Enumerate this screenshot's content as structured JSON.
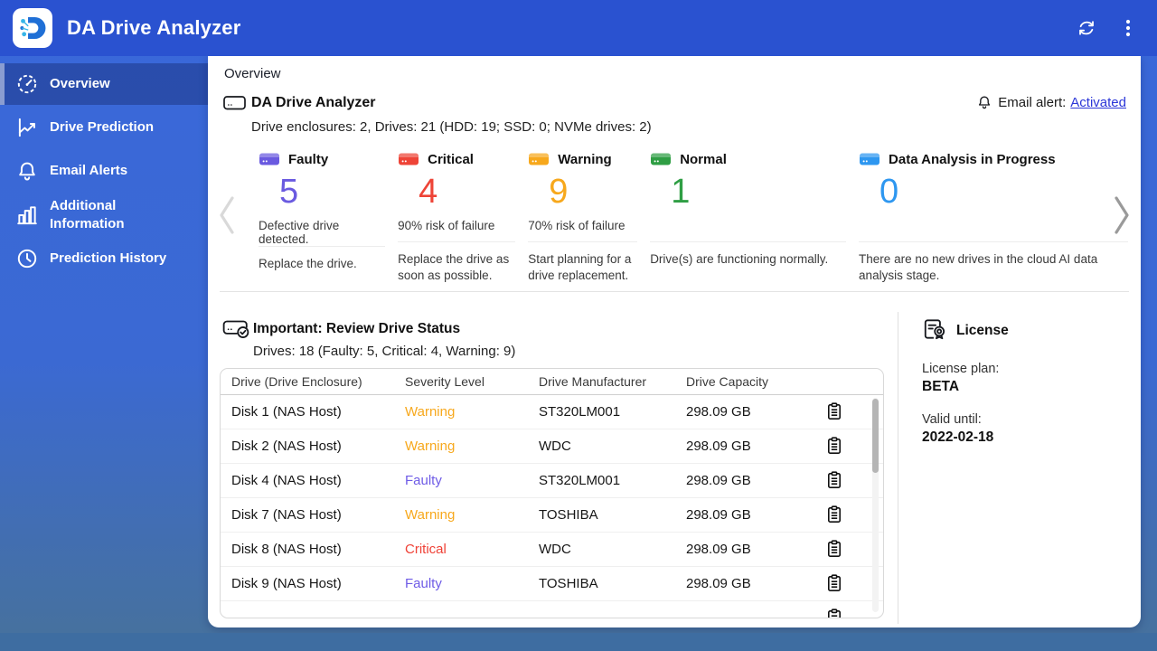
{
  "topbar": {
    "title": "DA Drive Analyzer",
    "actions": [
      {
        "name": "refresh",
        "icon": "refresh-icon"
      },
      {
        "name": "more-options",
        "icon": "kebab-icon"
      }
    ]
  },
  "sidebar": {
    "items": [
      {
        "label": "Overview",
        "icon": "gauge-icon",
        "selected": true
      },
      {
        "label": "Drive Prediction",
        "icon": "linechart-icon",
        "selected": false
      },
      {
        "label": "Email Alerts",
        "icon": "bell-icon",
        "selected": false
      },
      {
        "label": "Additional Information",
        "icon": "barchart-icon",
        "selected": false
      },
      {
        "label": "Prediction History",
        "icon": "clock-icon",
        "selected": false
      }
    ]
  },
  "content": {
    "tab_label": "Overview",
    "summary": {
      "title": "DA Drive Analyzer",
      "subtitle": "Drive enclosures: 2, Drives: 21 (HDD: 19; SSD: 0; NVMe drives: 2)",
      "email_alert_label": "Email alert:",
      "email_alert_link": "Activated"
    },
    "status_cards": [
      {
        "label": "Faulty",
        "count": "5",
        "subtitle": "Defective drive detected.",
        "description": "Replace the drive.",
        "color": "#6a5ae0"
      },
      {
        "label": "Critical",
        "count": "4",
        "subtitle": "90% risk of failure",
        "description": "Replace the drive as soon as possible.",
        "color": "#ee4437"
      },
      {
        "label": "Warning",
        "count": "9",
        "subtitle": "70% risk of failure",
        "description": "Start planning for a drive replacement.",
        "color": "#f7a81c"
      },
      {
        "label": "Normal",
        "count": "1",
        "subtitle": "",
        "description": "Drive(s) are functioning normally.",
        "color": "#2f9e44"
      },
      {
        "label": "Data Analysis in Progress",
        "count": "0",
        "subtitle": "",
        "description": "There are no new drives in the cloud AI data analysis stage.",
        "color": "#2e97f0"
      }
    ],
    "review": {
      "title": "Important: Review Drive Status",
      "subtitle": "Drives: 18 (Faulty: 5, Critical: 4, Warning: 9)",
      "table": {
        "headers": [
          "Drive (Drive Enclosure)",
          "Severity Level",
          "Drive Manufacturer",
          "Drive Capacity"
        ],
        "rows": [
          {
            "drive": "Disk 1 (NAS Host)",
            "severity": "Warning",
            "severity_color": "#f7a81c",
            "manufacturer": "ST320LM001",
            "capacity": "298.09 GB"
          },
          {
            "drive": "Disk 2 (NAS Host)",
            "severity": "Warning",
            "severity_color": "#f7a81c",
            "manufacturer": "WDC",
            "capacity": "298.09 GB"
          },
          {
            "drive": "Disk 4 (NAS Host)",
            "severity": "Faulty",
            "severity_color": "#6e5be6",
            "manufacturer": "ST320LM001",
            "capacity": "298.09 GB"
          },
          {
            "drive": "Disk 7 (NAS Host)",
            "severity": "Warning",
            "severity_color": "#f7a81c",
            "manufacturer": "TOSHIBA",
            "capacity": "298.09 GB"
          },
          {
            "drive": "Disk 8 (NAS Host)",
            "severity": "Critical",
            "severity_color": "#ef4136",
            "manufacturer": "WDC",
            "capacity": "298.09 GB"
          },
          {
            "drive": "Disk 9 (NAS Host)",
            "severity": "Faulty",
            "severity_color": "#6e5be6",
            "manufacturer": "TOSHIBA",
            "capacity": "298.09 GB"
          },
          {
            "drive": "",
            "severity": "",
            "severity_color": "",
            "manufacturer": "",
            "capacity": ""
          }
        ]
      }
    },
    "license": {
      "title": "License",
      "plan_label": "License plan:",
      "plan_value": "BETA",
      "valid_label": "Valid until:",
      "valid_value": "2022-02-18"
    }
  },
  "colors": {
    "topbar": "#2a52d0",
    "sidebar_top": "#3968da",
    "background_bottom": "#46719f",
    "bottom_strip": "#3e6da1",
    "link": "#2b36d8",
    "faulty": "#6a5ae0",
    "critical": "#ee4437",
    "warning": "#f7a81c",
    "normal": "#2f9e44",
    "analysis": "#2e97f0"
  }
}
